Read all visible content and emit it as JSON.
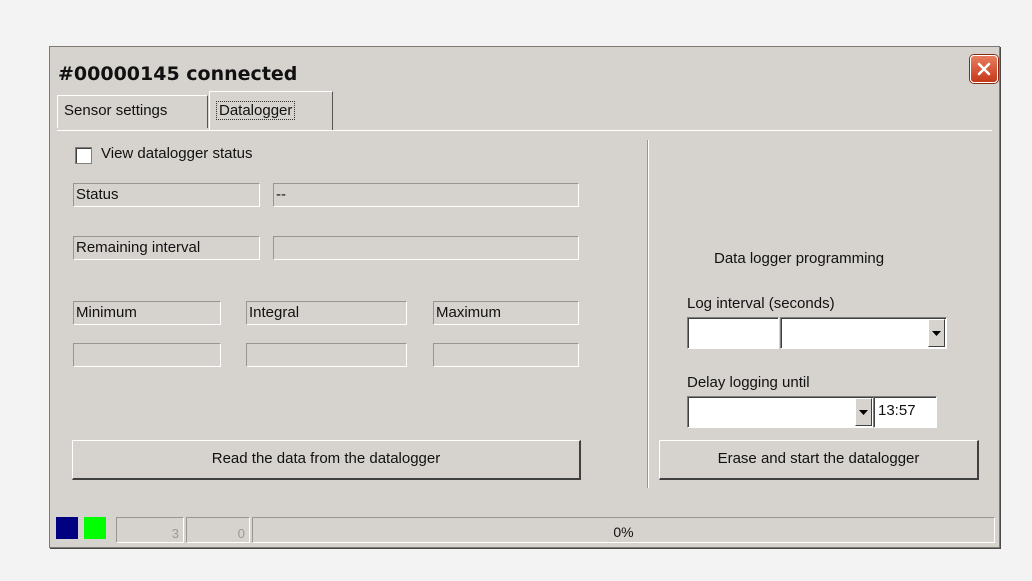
{
  "window": {
    "title": "#00000145 connected"
  },
  "tabs": [
    {
      "label": "Sensor settings"
    },
    {
      "label": "Datalogger"
    }
  ],
  "datalogger": {
    "view_status_label": "View datalogger status",
    "status_label": "Status",
    "status_value": "--",
    "remaining_interval_label": "Remaining interval",
    "remaining_interval_value": "",
    "minimum_label": "Minimum",
    "integral_label": "Integral",
    "maximum_label": "Maximum",
    "minimum_value": "",
    "integral_value": "",
    "maximum_value": "",
    "read_button": "Read the data from the datalogger"
  },
  "programming": {
    "heading": "Data logger programming",
    "log_interval_label": "Log interval (seconds)",
    "log_interval_value": "",
    "log_interval_unit": "",
    "delay_label": "Delay logging until",
    "delay_date": "",
    "delay_time": "13:57",
    "erase_button": "Erase and start the datalogger"
  },
  "statusbar": {
    "count1": "3",
    "count2": "0",
    "progress": "0%",
    "indicator_colors": [
      "#000080",
      "#00ff00"
    ]
  }
}
